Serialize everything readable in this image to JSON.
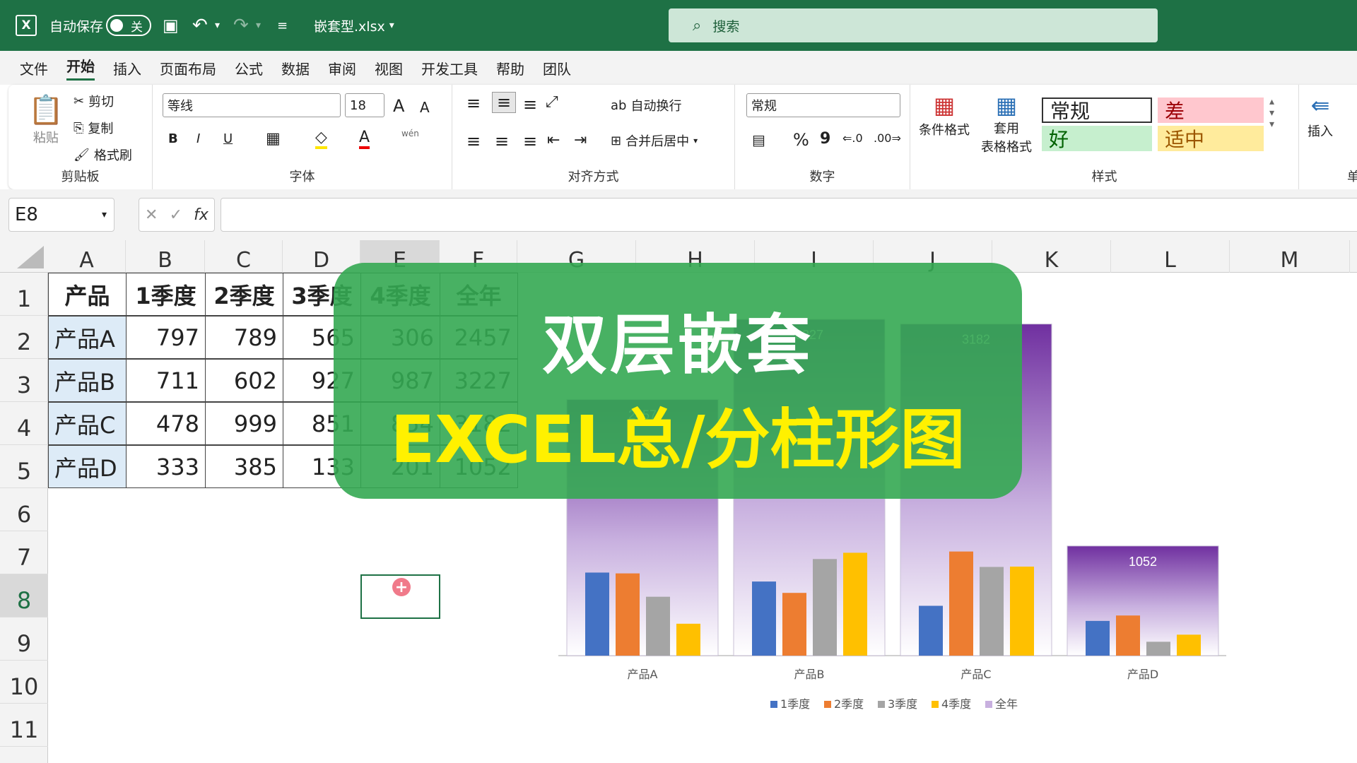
{
  "titlebar": {
    "autosave_label": "自动保存",
    "autosave_state": "关",
    "filename": "嵌套型.xlsx",
    "search_placeholder": "搜索"
  },
  "menu": [
    "文件",
    "开始",
    "插入",
    "页面布局",
    "公式",
    "数据",
    "审阅",
    "视图",
    "开发工具",
    "帮助",
    "团队"
  ],
  "ribbon": {
    "clipboard": {
      "paste": "粘贴",
      "cut": "剪切",
      "copy": "复制",
      "format_painter": "格式刷",
      "label": "剪贴板"
    },
    "font": {
      "name": "等线",
      "size": "18",
      "bold": "B",
      "italic": "I",
      "underline": "U",
      "label": "字体",
      "grow": "A",
      "shrink": "A",
      "pinyin": "wén"
    },
    "align": {
      "wrap": "自动换行",
      "merge": "合并后居中",
      "label": "对齐方式"
    },
    "number": {
      "format": "常规",
      "percent": "%",
      "comma": "9",
      "label": "数字"
    },
    "styles": {
      "cond": "条件格式",
      "table1": "套用",
      "table2": "表格格式",
      "normal": "常规",
      "bad": "差",
      "good": "好",
      "neutral": "适中",
      "label": "样式"
    },
    "cells": {
      "insert": "插入",
      "label": "单"
    }
  },
  "formula_bar": {
    "name_box": "E8",
    "fx": "fx",
    "formula": ""
  },
  "columns": [
    "A",
    "B",
    "C",
    "D",
    "E",
    "F",
    "G",
    "H",
    "I",
    "J",
    "K",
    "L",
    "M"
  ],
  "rows": [
    "1",
    "2",
    "3",
    "4",
    "5",
    "6",
    "7",
    "8",
    "9",
    "10",
    "11"
  ],
  "table": {
    "header": [
      "产品",
      "1季度",
      "2季度",
      "3季度",
      "4季度",
      "全年"
    ],
    "rows": [
      [
        "产品A",
        "797",
        "789",
        "565",
        "306",
        "2457"
      ],
      [
        "产品B",
        "711",
        "602",
        "927",
        "987",
        "3227"
      ],
      [
        "产品C",
        "478",
        "999",
        "851",
        "854",
        "3182"
      ],
      [
        "产品D",
        "333",
        "385",
        "133",
        "201",
        "1052"
      ]
    ]
  },
  "overlay": {
    "line1": "双层嵌套",
    "line2": "EXCEL总/分柱形图"
  },
  "chart_data": {
    "type": "bar",
    "categories": [
      "产品A",
      "产品B",
      "产品C",
      "产品D"
    ],
    "series": [
      {
        "name": "1季度",
        "values": [
          797,
          711,
          478,
          333
        ],
        "color": "#4472c4"
      },
      {
        "name": "2季度",
        "values": [
          789,
          602,
          999,
          385
        ],
        "color": "#ed7d31"
      },
      {
        "name": "3季度",
        "values": [
          565,
          927,
          851,
          133
        ],
        "color": "#a5a5a5"
      },
      {
        "name": "4季度",
        "values": [
          306,
          987,
          854,
          201
        ],
        "color": "#ffc000"
      },
      {
        "name": "全年",
        "values": [
          2457,
          3227,
          3182,
          1052
        ],
        "color": "#7030a0"
      }
    ],
    "data_labels": [
      "2457",
      "3227",
      "3182",
      "1052"
    ],
    "legend": "bottom"
  }
}
